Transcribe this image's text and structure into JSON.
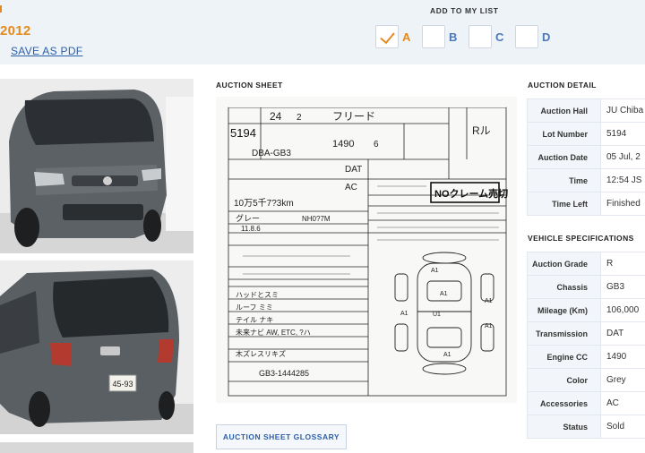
{
  "header": {
    "year": "2012",
    "save_pdf": "SAVE AS PDF"
  },
  "my_list": {
    "title": "ADD TO MY LIST",
    "items": [
      {
        "label": "A",
        "checked": true
      },
      {
        "label": "B",
        "checked": false
      },
      {
        "label": "C",
        "checked": false
      },
      {
        "label": "D",
        "checked": false
      }
    ]
  },
  "auction_sheet": {
    "title": "AUCTION SHEET",
    "glossary_button": "AUCTION SHEET GLOSSARY",
    "text": {
      "lot": "5194",
      "year": "24",
      "month": "2",
      "model": "フリード",
      "model_code": "DBA-GB3",
      "cc": "1490",
      "trans": "DAT",
      "ac": "AC",
      "grade": "R",
      "mileage": "10万5千7?3km",
      "color": "グレー",
      "color_code": "NH0?7M",
      "date": "11.8.6",
      "chassis": "GB3-1444285",
      "stamp": "NOクレーム売切",
      "grade_box": "Rル",
      "seats": "6",
      "notes": [
        "ハッドとスミ",
        "ルーフ ミミ",
        "テイル ナキ",
        "未来ナビ AW, ETC, ?ハ",
        "木ズレスリキズ"
      ]
    }
  },
  "auction_detail": {
    "title": "AUCTION DETAIL",
    "rows": [
      {
        "key": "Auction Hall",
        "value": "JU Chiba",
        "style": "green"
      },
      {
        "key": "Lot Number",
        "value": "5194",
        "style": ""
      },
      {
        "key": "Auction Date",
        "value": "05 Jul, 2",
        "style": ""
      },
      {
        "key": "Time",
        "value": "12:54 JS",
        "style": ""
      },
      {
        "key": "Time Left",
        "value": "Finished",
        "style": "red"
      }
    ]
  },
  "vehicle_specs": {
    "title": "VEHICLE SPECIFICATIONS",
    "rows": [
      {
        "key": "Auction Grade",
        "value": "R"
      },
      {
        "key": "Chassis",
        "value": "GB3"
      },
      {
        "key": "Mileage (Km)",
        "value": "106,000"
      },
      {
        "key": "Transmission",
        "value": "DAT"
      },
      {
        "key": "Engine CC",
        "value": "1490"
      },
      {
        "key": "Color",
        "value": "Grey"
      },
      {
        "key": "Accessories",
        "value": "AC"
      },
      {
        "key": "Status",
        "value": "Sold"
      }
    ]
  },
  "photos": {
    "plate": "45-93"
  }
}
